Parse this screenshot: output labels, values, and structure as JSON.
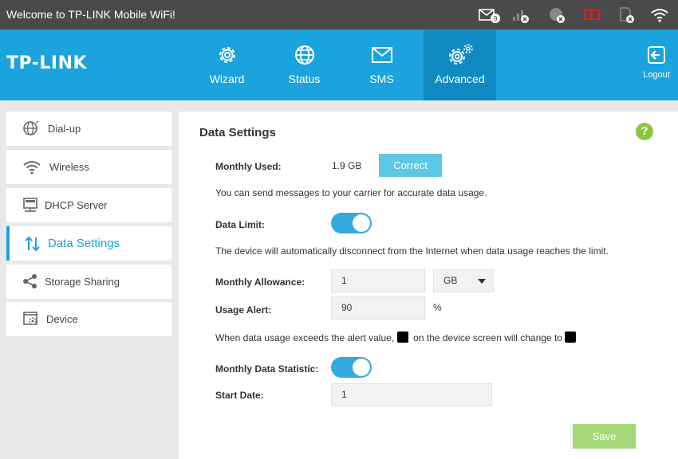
{
  "statusbar": {
    "title": "Welcome to TP-LINK Mobile WiFi!",
    "sms_count": "9",
    "icons": [
      "sms-icon",
      "signal-icon",
      "internet-icon",
      "battery-icon",
      "sim-icon",
      "wifi-icon"
    ]
  },
  "header": {
    "logo": "TP-LINK",
    "nav": [
      {
        "label": "Wizard",
        "icon": "gear-icon"
      },
      {
        "label": "Status",
        "icon": "globe-icon"
      },
      {
        "label": "SMS",
        "icon": "envelope-icon"
      },
      {
        "label": "Advanced",
        "icon": "gears-icon"
      }
    ],
    "logout_label": "Logout",
    "active_nav": "Advanced"
  },
  "sidebar": {
    "items": [
      {
        "label": "Dial-up",
        "icon": "globe-icon"
      },
      {
        "label": "Wireless",
        "icon": "wifi-icon"
      },
      {
        "label": "DHCP Server",
        "icon": "server-icon"
      },
      {
        "label": "Data Settings",
        "icon": "data-arrows-icon"
      },
      {
        "label": "Storage Sharing",
        "icon": "share-icon"
      },
      {
        "label": "Device",
        "icon": "device-settings-icon"
      }
    ],
    "active": "Data Settings"
  },
  "main": {
    "title": "Data Settings",
    "help_label": "?",
    "monthly_used_label": "Monthly Used:",
    "monthly_used_value": "1.9 GB",
    "correct_button": "Correct",
    "carrier_note": "You can send messages to your carrier for accurate data usage.",
    "data_limit_label": "Data Limit:",
    "data_limit_on": true,
    "disconnect_note": "The device will automatically disconnect from the Internet when data usage reaches the limit.",
    "monthly_allowance_label": "Monthly Allowance:",
    "monthly_allowance_value": "1",
    "unit_selected": "GB",
    "usage_alert_label": "Usage Alert:",
    "usage_alert_value": "90",
    "percent_sign": "%",
    "alert_note_a": "When data usage exceeds the alert value,",
    "alert_note_b": "on the device screen will change to",
    "monthly_statistic_label": "Monthly Data Statistic:",
    "monthly_statistic_on": true,
    "start_date_label": "Start Date:",
    "start_date_value": "1",
    "save_button": "Save"
  },
  "colors": {
    "header": "#1aa3dc",
    "active_nav": "#0f8ac1",
    "statusbar": "#4a4a4a",
    "toggle_on": "#34a9db",
    "correct_button": "#5bc8e6",
    "save_button": "#a5d878",
    "help": "#8cc63f"
  }
}
